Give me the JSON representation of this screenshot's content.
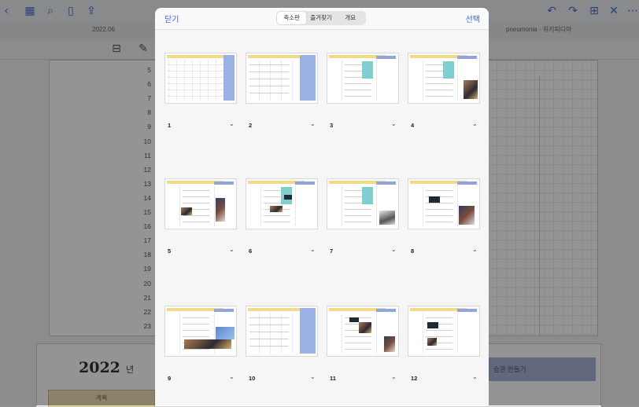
{
  "bg_toolbar": {
    "icons": [
      "back-chevron-icon",
      "grid-icon",
      "search-icon",
      "bookmark-icon",
      "share-icon"
    ],
    "right_icons": [
      "undo-icon",
      "redo-icon",
      "add-page-icon",
      "close-icon",
      "more-icon"
    ]
  },
  "bg_tabs": {
    "left_tab": "2022.06",
    "right_tab": "pneumonia - 위키피디아"
  },
  "bg_page": {
    "row_numbers": [
      "5",
      "6",
      "7",
      "8",
      "9",
      "10",
      "11",
      "12",
      "13",
      "14",
      "15",
      "16",
      "17",
      "18",
      "19",
      "20",
      "21",
      "22",
      "23"
    ]
  },
  "bg_bottom": {
    "year": "2022",
    "year_suffix": "년",
    "plan_label": "계획",
    "habit_label": "습관 만들기"
  },
  "modal": {
    "close": "닫기",
    "select": "선택",
    "segments": [
      "축소판",
      "즐겨찾기",
      "개요"
    ],
    "active_segment": "축소판",
    "pages": [
      {
        "label": "1"
      },
      {
        "label": "2"
      },
      {
        "label": "3"
      },
      {
        "label": "4"
      },
      {
        "label": "5"
      },
      {
        "label": "6"
      },
      {
        "label": "7"
      },
      {
        "label": "8"
      },
      {
        "label": "9"
      },
      {
        "label": "10"
      },
      {
        "label": "11"
      },
      {
        "label": "12"
      }
    ]
  },
  "colors": {
    "accent": "#3a68d8",
    "thumb_yellow": "#f3d98a",
    "thumb_blue": "#8ea5e0"
  }
}
